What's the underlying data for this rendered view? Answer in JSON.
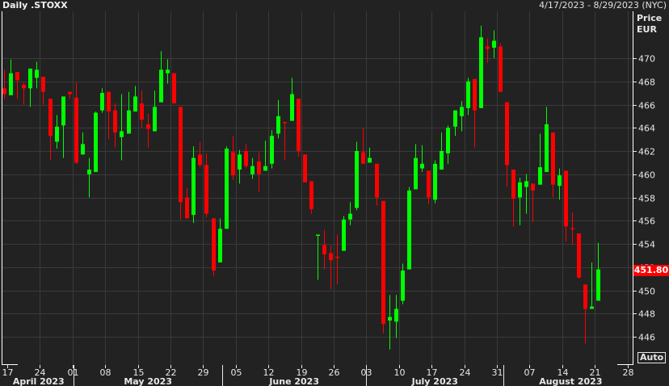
{
  "header": {
    "title": "Daily .STOXX",
    "range": "4/17/2023 - 8/29/2023 (NYC)"
  },
  "axis": {
    "price_label": "Price",
    "currency": "EUR",
    "last_price": "451.80",
    "auto_label": "Auto"
  },
  "colors": {
    "up": "#00ff00",
    "down": "#ff0000",
    "background": "#222222",
    "grid": "#3a3a3a",
    "last_price_bg": "#ff0000"
  },
  "chart_data": {
    "type": "candlestick",
    "title": "Daily .STOXX",
    "ylabel": "Price EUR",
    "ylim": [
      444.2,
      474.2
    ],
    "yticks": [
      446,
      448,
      450,
      452,
      454,
      456,
      458,
      460,
      462,
      464,
      466,
      468,
      470
    ],
    "xticks": [
      {
        "i": 0,
        "label": "17"
      },
      {
        "i": 5,
        "label": "24"
      },
      {
        "i": 10,
        "label": "01"
      },
      {
        "i": 15,
        "label": "08"
      },
      {
        "i": 20,
        "label": "15"
      },
      {
        "i": 25,
        "label": "22"
      },
      {
        "i": 30,
        "label": "29"
      },
      {
        "i": 35,
        "label": "05"
      },
      {
        "i": 40,
        "label": "12"
      },
      {
        "i": 45,
        "label": "19"
      },
      {
        "i": 50,
        "label": "26"
      },
      {
        "i": 55,
        "label": "03"
      },
      {
        "i": 60,
        "label": "10"
      },
      {
        "i": 65,
        "label": "17"
      },
      {
        "i": 70,
        "label": "24"
      },
      {
        "i": 75,
        "label": "31"
      },
      {
        "i": 80,
        "label": "07"
      },
      {
        "i": 85,
        "label": "14"
      },
      {
        "i": 90,
        "label": "21"
      },
      {
        "i": 95,
        "label": "28"
      }
    ],
    "months": [
      {
        "label": "April 2023",
        "start": -0.6,
        "end": 10.2
      },
      {
        "label": "May 2023",
        "start": 10.2,
        "end": 32.9
      },
      {
        "label": "June 2023",
        "start": 32.9,
        "end": 55
      },
      {
        "label": "July 2023",
        "start": 55,
        "end": 76
      },
      {
        "label": "August 2023",
        "start": 76,
        "end": 96.6
      }
    ],
    "ohlc_fields": [
      "open",
      "high",
      "low",
      "close"
    ],
    "candles": [
      [
        467.4,
        469.0,
        466.5,
        466.9
      ],
      [
        466.8,
        469.9,
        466.8,
        468.7
      ],
      [
        468.8,
        468.8,
        466.5,
        468.1
      ],
      [
        467.7,
        467.9,
        466.0,
        467.4
      ],
      [
        467.4,
        469.1,
        465.8,
        469.1
      ],
      [
        468.3,
        469.7,
        467.4,
        469.0
      ],
      [
        468.4,
        468.4,
        466.0,
        467.1
      ],
      [
        466.5,
        466.5,
        461.2,
        463.3
      ],
      [
        462.8,
        465.1,
        462.2,
        464.1
      ],
      [
        464.2,
        466.7,
        461.4,
        466.7
      ],
      [
        467.1,
        467.1,
        466.5,
        466.9
      ],
      [
        466.6,
        467.9,
        460.9,
        461.0
      ],
      [
        461.7,
        463.6,
        461.7,
        462.6
      ],
      [
        460.0,
        461.4,
        458.0,
        460.4
      ],
      [
        460.2,
        465.4,
        460.2,
        465.3
      ],
      [
        465.5,
        467.4,
        465.3,
        467.0
      ],
      [
        467.1,
        467.1,
        463.0,
        465.4
      ],
      [
        465.5,
        466.1,
        462.3,
        463.6
      ],
      [
        463.2,
        466.9,
        461.2,
        463.7
      ],
      [
        463.5,
        467.1,
        463.5,
        465.5
      ],
      [
        465.4,
        467.6,
        465.4,
        466.7
      ],
      [
        466.1,
        467.2,
        464.0,
        464.7
      ],
      [
        464.3,
        465.2,
        462.3,
        463.9
      ],
      [
        463.7,
        467.2,
        463.7,
        465.8
      ],
      [
        466.2,
        470.6,
        466.2,
        469.0
      ],
      [
        468.7,
        469.9,
        467.8,
        469.0
      ],
      [
        468.7,
        468.7,
        466.1,
        466.1
      ],
      [
        465.8,
        465.8,
        456.1,
        457.6
      ],
      [
        458.0,
        458.8,
        456.2,
        456.2
      ],
      [
        456.5,
        462.4,
        455.8,
        461.4
      ],
      [
        461.7,
        462.8,
        460.6,
        460.8
      ],
      [
        460.8,
        461.8,
        456.3,
        456.6
      ],
      [
        456.2,
        456.2,
        451.2,
        451.7
      ],
      [
        452.4,
        456.2,
        452.4,
        455.3
      ],
      [
        455.3,
        462.4,
        455.3,
        462.2
      ],
      [
        461.9,
        463.3,
        459.5,
        459.9
      ],
      [
        460.4,
        462.1,
        459.2,
        461.7
      ],
      [
        462.0,
        462.6,
        460.5,
        460.7
      ],
      [
        460.0,
        461.4,
        459.6,
        460.7
      ],
      [
        461.1,
        461.9,
        458.5,
        460.0
      ],
      [
        460.3,
        462.9,
        460.3,
        460.7
      ],
      [
        460.9,
        463.8,
        460.5,
        463.3
      ],
      [
        463.5,
        466.4,
        463.1,
        465.0
      ],
      [
        464.5,
        464.5,
        461.2,
        464.4
      ],
      [
        464.6,
        468.3,
        464.6,
        466.9
      ],
      [
        466.5,
        466.5,
        461.5,
        462.0
      ],
      [
        461.7,
        461.7,
        459.3,
        459.3
      ],
      [
        459.4,
        459.4,
        456.6,
        457.0
      ],
      [
        454.7,
        454.8,
        450.9,
        454.8
      ],
      [
        453.9,
        455.2,
        451.8,
        453.1
      ],
      [
        453.2,
        453.9,
        450.1,
        452.6
      ],
      [
        452.9,
        454.8,
        450.5,
        452.85
      ],
      [
        453.4,
        456.4,
        453.4,
        456.1
      ],
      [
        456.1,
        457.6,
        455.6,
        456.6
      ],
      [
        457.1,
        462.8,
        456.9,
        462.0
      ],
      [
        461.9,
        464.0,
        460.9,
        460.9
      ],
      [
        461.0,
        462.3,
        461.0,
        461.4
      ],
      [
        460.9,
        460.9,
        457.3,
        458.0
      ],
      [
        457.7,
        457.7,
        446.3,
        447.1
      ],
      [
        447.4,
        449.6,
        444.9,
        447.7
      ],
      [
        447.3,
        449.6,
        445.9,
        448.4
      ],
      [
        449.1,
        452.3,
        448.8,
        451.7
      ],
      [
        451.8,
        458.9,
        451.8,
        458.6
      ],
      [
        458.7,
        462.6,
        458.7,
        461.4
      ],
      [
        460.5,
        462.5,
        460.2,
        460.9
      ],
      [
        460.3,
        460.3,
        457.4,
        458.0
      ],
      [
        457.8,
        461.2,
        457.5,
        460.9
      ],
      [
        460.4,
        463.6,
        460.4,
        462.0
      ],
      [
        461.8,
        464.2,
        460.9,
        464.0
      ],
      [
        464.1,
        465.5,
        463.3,
        465.5
      ],
      [
        465.0,
        466.3,
        463.7,
        465.8
      ],
      [
        465.7,
        468.3,
        465.1,
        468.0
      ],
      [
        468.2,
        468.2,
        462.3,
        465.5
      ],
      [
        465.7,
        472.8,
        465.7,
        471.8
      ],
      [
        471.0,
        471.7,
        469.6,
        470.8
      ],
      [
        470.9,
        472.4,
        470.0,
        471.5
      ],
      [
        471.0,
        471.3,
        467.1,
        467.1
      ],
      [
        466.2,
        466.2,
        458.9,
        460.8
      ],
      [
        460.4,
        460.4,
        455.5,
        457.9
      ],
      [
        458.0,
        459.7,
        455.6,
        459.3
      ],
      [
        458.9,
        460.0,
        456.6,
        459.4
      ],
      [
        459.2,
        459.2,
        455.9,
        458.6
      ],
      [
        459.1,
        463.5,
        459.1,
        460.6
      ],
      [
        460.2,
        465.8,
        460.2,
        464.3
      ],
      [
        463.6,
        463.6,
        458.0,
        459.1
      ],
      [
        459.0,
        460.5,
        457.8,
        459.9
      ],
      [
        460.3,
        460.3,
        454.2,
        455.5
      ],
      [
        455.35,
        456.7,
        453.9,
        455.3
      ],
      [
        454.9,
        454.9,
        451.0,
        451.1
      ],
      [
        450.5,
        450.5,
        445.4,
        448.4
      ],
      [
        448.4,
        452.4,
        448.4,
        448.6
      ],
      [
        449.1,
        454.1,
        449.1,
        451.8
      ]
    ]
  }
}
